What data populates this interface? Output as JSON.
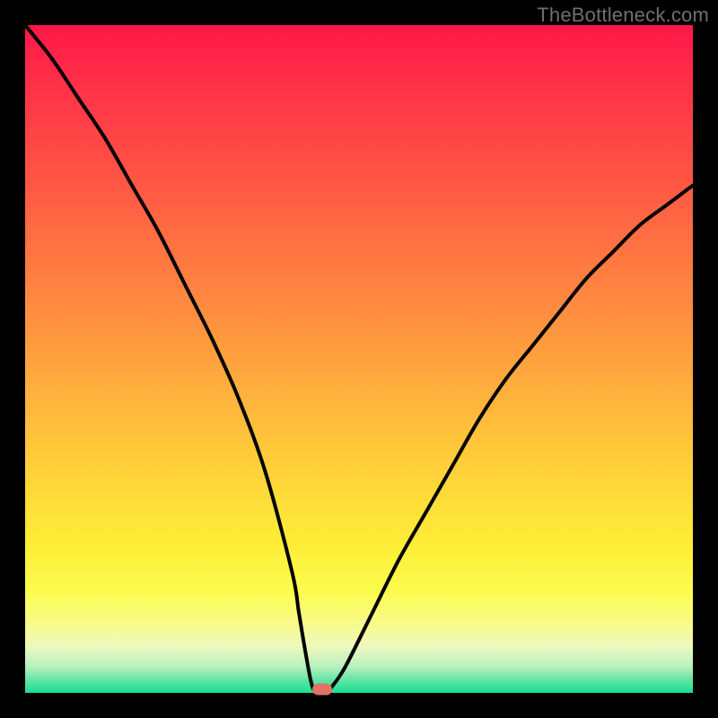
{
  "watermark": "TheBottleneck.com",
  "colors": {
    "background": "#000000",
    "curve": "#000000",
    "marker": "#e27268",
    "gradient_top": "#ff1748",
    "gradient_bottom": "#17de92"
  },
  "chart_data": {
    "type": "line",
    "title": "",
    "xlabel": "",
    "ylabel": "",
    "xlim": [
      0,
      100
    ],
    "ylim": [
      0,
      100
    ],
    "description": "Bottleneck curve: V-shaped curve reaching minimum near x≈44, y≈0. Left branch starts at top-left corner; right branch ends mid-right edge.",
    "series": [
      {
        "name": "bottleneck-curve",
        "x": [
          0,
          4,
          8,
          12,
          16,
          20,
          24,
          28,
          32,
          36,
          40,
          41,
          42,
          43,
          44,
          45,
          46,
          48,
          52,
          56,
          60,
          64,
          68,
          72,
          76,
          80,
          84,
          88,
          92,
          96,
          100
        ],
        "y": [
          100,
          95,
          89,
          83,
          76,
          69,
          61,
          53,
          44,
          33,
          18,
          12,
          6,
          1,
          0,
          0,
          1,
          4,
          12,
          20,
          27,
          34,
          41,
          47,
          52,
          57,
          62,
          66,
          70,
          73,
          76
        ]
      }
    ],
    "marker": {
      "x": 44.5,
      "y": 0.5
    }
  }
}
